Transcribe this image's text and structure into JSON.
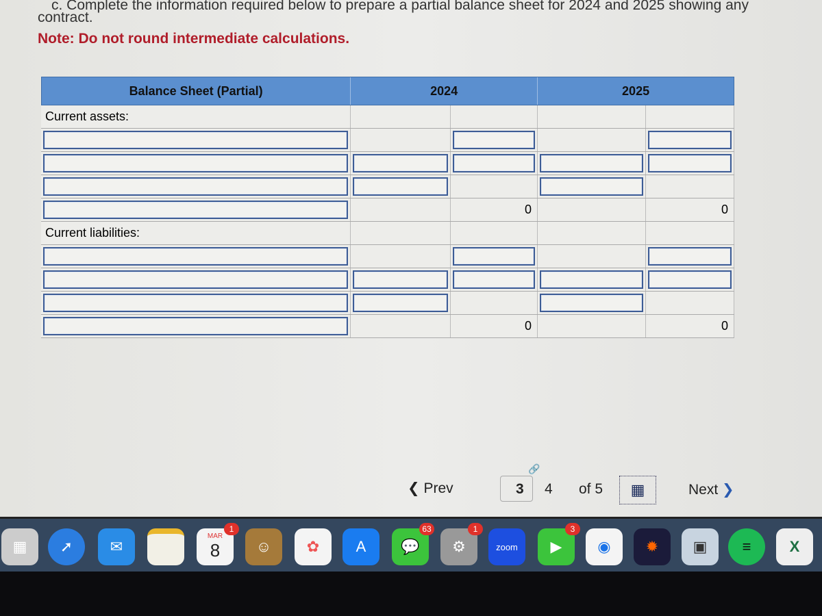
{
  "instructions": {
    "line1": "c. Complete the information required below to prepare a partial balance sheet for 2024 and 2025 showing any",
    "line2": "contract.",
    "note": "Note: Do not round intermediate calculations."
  },
  "table": {
    "title": "Balance Sheet (Partial)",
    "col_2024": "2024",
    "col_2025": "2025",
    "current_assets_label": "Current assets:",
    "current_liabilities_label": "Current liabilities:",
    "assets_total_2024": "0",
    "assets_total_2025": "0",
    "liab_total_2024": "0",
    "liab_total_2025": "0"
  },
  "pager": {
    "prev": "Prev",
    "current": "3",
    "next_page": "4",
    "of": "of 5",
    "next": "Next"
  },
  "dock": {
    "calendar_month": "MAR",
    "calendar_day": "8",
    "calendar_badge": "1",
    "messages_badge": "63",
    "settings_badge": "1",
    "facetime_badge": "3",
    "zoom_label": "zoom"
  },
  "colors": {
    "header": "#5b8fcf",
    "note": "#b01d2a",
    "dock": "#34475e"
  }
}
